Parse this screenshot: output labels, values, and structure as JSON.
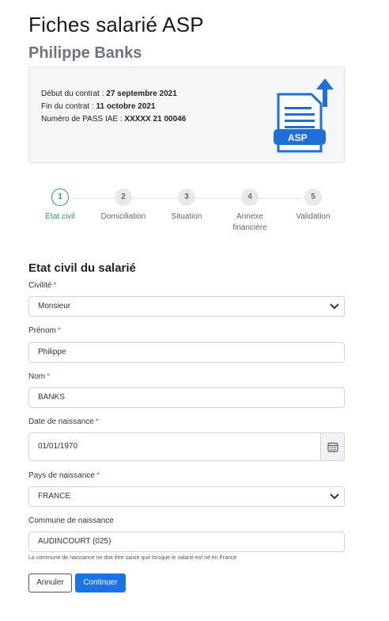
{
  "header": {
    "title": "Fiches salarié ASP",
    "subtitle": "Philippe Banks"
  },
  "contract": {
    "start_label": "Début du contrat : ",
    "start_value": "27 septembre 2021",
    "end_label": "Fin du contrat : ",
    "end_value": "11 octobre 2021",
    "pass_label": "Numéro de PASS IAE : ",
    "pass_value": "XXXXX 21 00046",
    "asp_badge": "ASP"
  },
  "stepper": {
    "steps": [
      {
        "number": "1",
        "label": "Etat civil",
        "active": true
      },
      {
        "number": "2",
        "label": "Domiciliation",
        "active": false
      },
      {
        "number": "3",
        "label": "Situation",
        "active": false
      },
      {
        "number": "4",
        "label": "Annexe financière",
        "active": false
      },
      {
        "number": "5",
        "label": "Validation",
        "active": false
      }
    ]
  },
  "form": {
    "section_title": "Etat civil du salarié",
    "required_mark": "*",
    "civilite": {
      "label": "Civilité",
      "value": "Monsieur"
    },
    "prenom": {
      "label": "Prénom",
      "value": "Philippe"
    },
    "nom": {
      "label": "Nom",
      "value": "BANKS"
    },
    "date_naissance": {
      "label": "Date de naissance",
      "value": "01/01/1970"
    },
    "pays_naissance": {
      "label": "Pays de naissance",
      "value": "FRANCE"
    },
    "commune_naissance": {
      "label": "Commune de naissance",
      "value": "AUDINCOURT (025)",
      "help": "La commune de naissance ne doit être saisie que lorsque le salarié est né en France"
    }
  },
  "actions": {
    "cancel_label": "Annuler",
    "continue_label": "Continuer"
  },
  "colors": {
    "accent_green": "#2e9e4f",
    "primary_blue": "#1a73e8",
    "required_red": "#d9534f"
  }
}
